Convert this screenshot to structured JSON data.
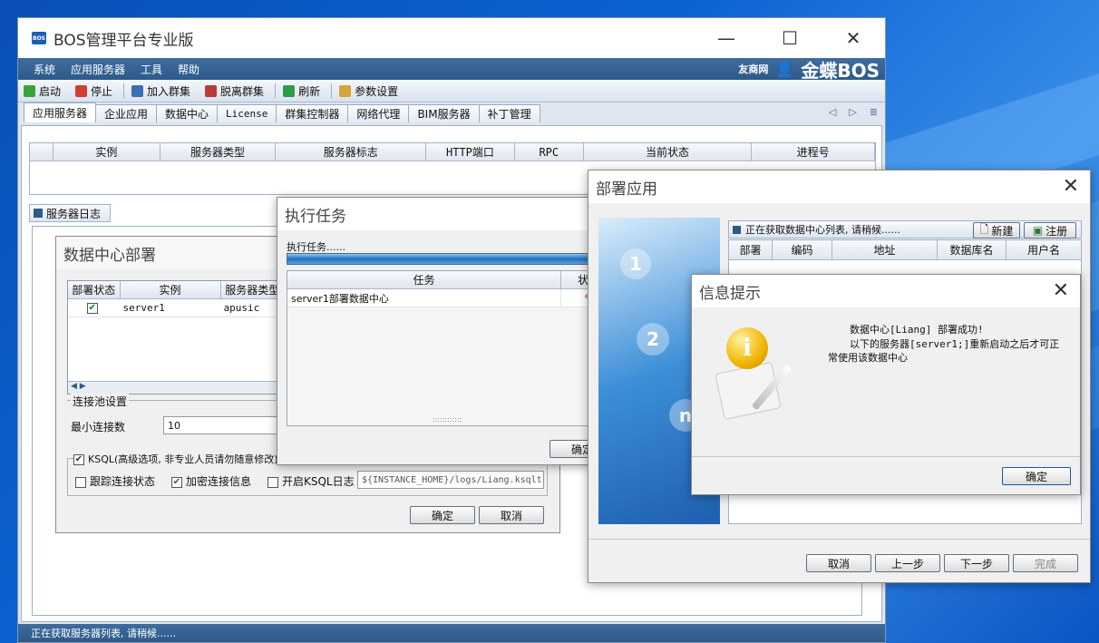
{
  "main": {
    "title": "BOS管理平台专业版",
    "menu": [
      "系统",
      "应用服务器",
      "工具",
      "帮助"
    ],
    "brand_yy": "友商网",
    "brand_kd": "金蝶BOS",
    "toolbar": {
      "start": "启动",
      "stop": "停止",
      "join": "加入群集",
      "leave": "脱离群集",
      "refresh": "刷新",
      "params": "参数设置"
    },
    "tabs": [
      "应用服务器",
      "企业应用",
      "数据中心",
      "License",
      "群集控制器",
      "网络代理",
      "BIM服务器",
      "补丁管理"
    ],
    "server_grid_headers": [
      "实例",
      "服务器类型",
      "服务器标志",
      "HTTP端口",
      "RPC",
      "当前状态",
      "进程号"
    ],
    "log_tab": "服务器日志",
    "status": "正在获取服务器列表, 请稍候......"
  },
  "dc_deploy": {
    "title": "数据中心部署",
    "headers": [
      "部署状态",
      "实例",
      "服务器类型"
    ],
    "row": {
      "instance": "server1",
      "type": "apusic"
    },
    "pool_legend": "连接池设置",
    "min_conn_label": "最小连接数",
    "min_conn_value": "10",
    "ksql_label": "KSQL(高级选项, 非专业人员请勿随意修改)",
    "trace_label": "跟踪连接状态",
    "encrypt_label": "加密连接信息",
    "ksql_log_label": "开启KSQL日志",
    "ksql_log_path": "${INSTANCE_HOME}/logs/Liang.ksqltr",
    "ok": "确定",
    "cancel": "取消"
  },
  "exec_task": {
    "title": "执行任务",
    "label": "执行任务......",
    "progress": 1.0,
    "headers": [
      "任务",
      "状态"
    ],
    "task": "server1部署数据中心",
    "ok": "确定"
  },
  "deploy_app": {
    "title": "部署应用",
    "loading": "正在获取数据中心列表, 请稍候......",
    "new": "新建",
    "register": "注册",
    "headers": [
      "部署",
      "编码",
      "地址",
      "数据库名",
      "用户名"
    ],
    "steps": [
      "1",
      "2",
      "n"
    ],
    "cancel": "取消",
    "prev": "上一步",
    "next": "下一步",
    "finish": "完成"
  },
  "info": {
    "title": "信息提示",
    "line1": "数据中心[Liang] 部署成功!",
    "line2": "以下的服务器[server1;]重新启动之后才可正",
    "line3": "常使用该数据中心",
    "ok": "确定"
  }
}
